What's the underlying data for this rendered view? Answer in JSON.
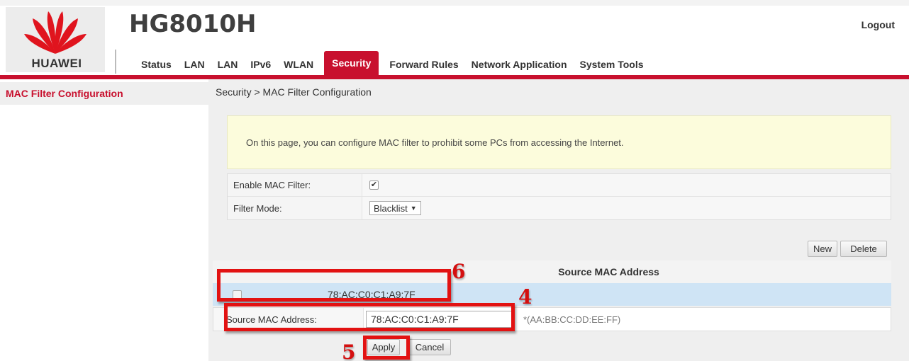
{
  "header": {
    "brand": "HUAWEI",
    "product": "HG8010H",
    "logout_label": "Logout",
    "brand_color": "#c8102e",
    "logo_icon": "huawei-flower-logo"
  },
  "nav": {
    "items": [
      {
        "label": "Status"
      },
      {
        "label": "LAN"
      },
      {
        "label": "LAN"
      },
      {
        "label": "IPv6"
      },
      {
        "label": "WLAN"
      },
      {
        "label": "Security",
        "active": true
      },
      {
        "label": "Forward Rules"
      },
      {
        "label": "Network Application"
      },
      {
        "label": "System Tools"
      }
    ]
  },
  "sidebar": {
    "items": [
      {
        "label": "MAC Filter Configuration",
        "active": true
      }
    ]
  },
  "main": {
    "breadcrumb": "Security > MAC Filter Configuration",
    "notice": "On this page, you can configure MAC filter to prohibit some PCs from accessing the Internet.",
    "enable_label": "Enable MAC Filter:",
    "enable_checked": true,
    "enable_check_glyph": "✔",
    "filter_mode_label": "Filter Mode:",
    "filter_mode_value": "Blacklist",
    "filter_mode_arrow": "▼",
    "new_label": "New",
    "delete_label": "Delete",
    "list": {
      "header": "Source MAC Address",
      "rows": [
        {
          "mac": "78:AC:C0:C1:A9:7F",
          "checked": false
        }
      ]
    },
    "edit": {
      "label": "Source MAC Address:",
      "value": "78:AC:C0:C1:A9:7F",
      "hint": "*(AA:BB:CC:DD:EE:FF)"
    },
    "apply_label": "Apply",
    "cancel_label": "Cancel"
  },
  "annotations": {
    "color": "#e21212",
    "steps": [
      {
        "number": "6",
        "target": "list-row"
      },
      {
        "number": "4",
        "target": "mac-address-field"
      },
      {
        "number": "5",
        "target": "apply-button"
      }
    ]
  }
}
